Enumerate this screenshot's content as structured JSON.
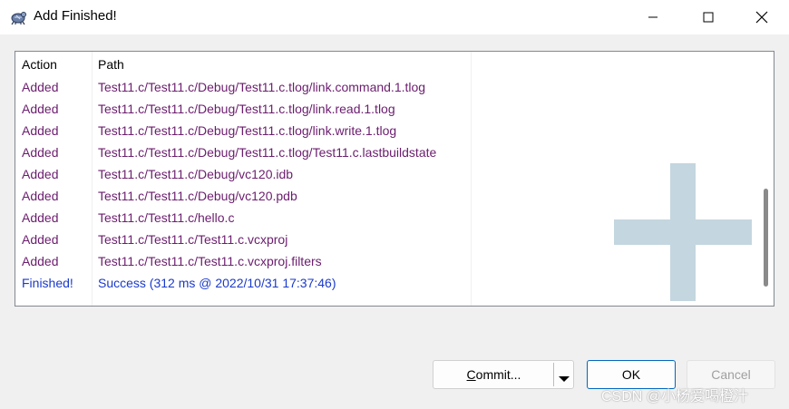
{
  "window": {
    "title": "Add Finished!",
    "minimize_icon": "minimize-icon",
    "maximize_icon": "maximize-icon",
    "close_icon": "close-icon"
  },
  "list": {
    "columns": [
      "Action",
      "Path"
    ],
    "rows": [
      {
        "action": "Added",
        "path": "Test11.c/Test11.c/Debug/Test11.c.tlog/link.command.1.tlog"
      },
      {
        "action": "Added",
        "path": "Test11.c/Test11.c/Debug/Test11.c.tlog/link.read.1.tlog"
      },
      {
        "action": "Added",
        "path": "Test11.c/Test11.c/Debug/Test11.c.tlog/link.write.1.tlog"
      },
      {
        "action": "Added",
        "path": "Test11.c/Test11.c/Debug/Test11.c.tlog/Test11.c.lastbuildstate"
      },
      {
        "action": "Added",
        "path": "Test11.c/Test11.c/Debug/vc120.idb"
      },
      {
        "action": "Added",
        "path": "Test11.c/Test11.c/Debug/vc120.pdb"
      },
      {
        "action": "Added",
        "path": "Test11.c/Test11.c/hello.c"
      },
      {
        "action": "Added",
        "path": "Test11.c/Test11.c/Test11.c.vcxproj"
      },
      {
        "action": "Added",
        "path": "Test11.c/Test11.c/Test11.c.vcxproj.filters"
      },
      {
        "action": "Finished!",
        "path": "Success (312 ms @ 2022/10/31 17:37:46)"
      }
    ],
    "colors": {
      "added": "#6b1d6e",
      "finished": "#1a3acb",
      "plus_watermark": "#c4d6e0"
    }
  },
  "buttons": {
    "commit_prefix": "",
    "commit_accel": "C",
    "commit_rest": "ommit...",
    "ok": "OK",
    "cancel": "Cancel"
  },
  "watermark": "CSDN @小杨爱喝橙汁"
}
